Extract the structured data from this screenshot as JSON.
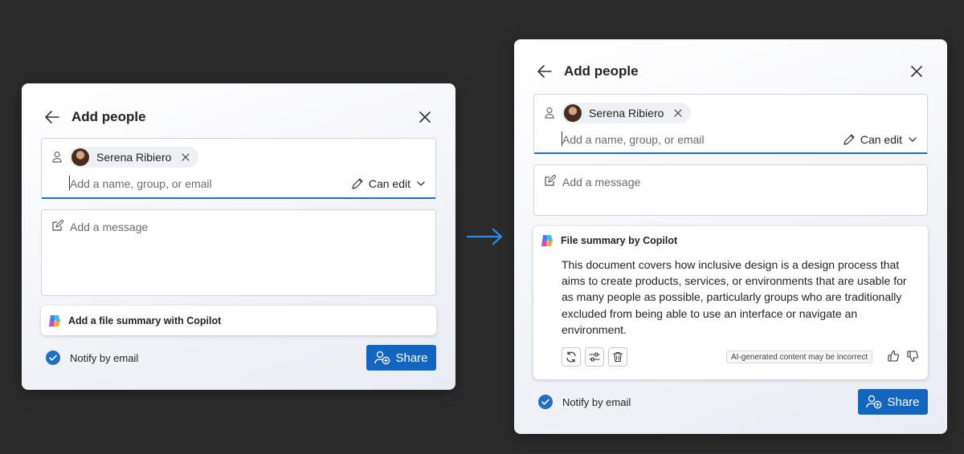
{
  "before": {
    "title": "Add people",
    "recipient": {
      "name": "Serena Ribiero"
    },
    "people_placeholder": "Add a name, group, or email",
    "permission": "Can edit",
    "message_placeholder": "Add a message",
    "copilot_button_label": "Add a file summary with Copilot",
    "notify_label": "Notify by email",
    "share_label": "Share"
  },
  "after": {
    "title": "Add people",
    "recipient": {
      "name": "Serena Ribiero"
    },
    "people_placeholder": "Add a name, group, or email",
    "permission": "Can edit",
    "message_placeholder": "Add a message",
    "summary": {
      "title": "File summary by Copilot",
      "lines": [
        "This document covers how inclusive design is a design process that",
        "aims to create products, services, or environments that are usable for",
        "as many people as possible, particularly groups who are traditionally",
        "excluded from being able to use an interface or navigate an",
        "environment."
      ],
      "disclaimer": "AI-generated content may be incorrect",
      "tools": [
        "regenerate-icon",
        "adjust-icon",
        "delete-icon"
      ]
    },
    "notify_label": "Notify by email",
    "share_label": "Share"
  },
  "theme": {
    "accent": "#1366c0",
    "underline": "#1f6fc4",
    "background": "#2b2b2b",
    "arrow": "#2a8cf0"
  }
}
